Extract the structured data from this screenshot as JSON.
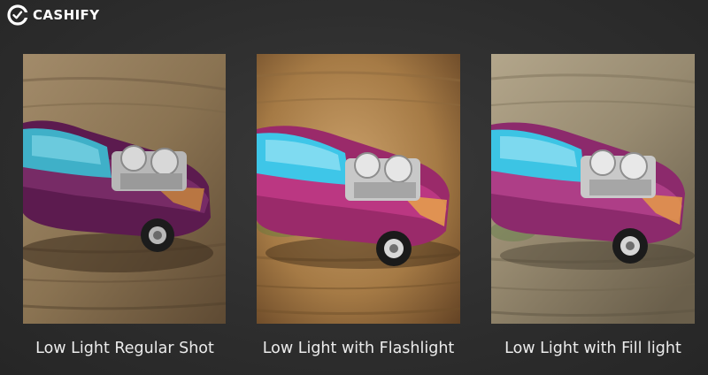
{
  "brand": {
    "name": "CASHIFY",
    "logo_icon": "cashify-logo-icon"
  },
  "comparison": [
    {
      "caption": "Low Light Regular Shot",
      "lighting": "low-light-regular",
      "palette": {
        "table": "#8f7756",
        "table_dark": "#4e3d2a",
        "grain": "#6e5a41",
        "car": "#5c1b4f",
        "car_hi": "#8a3a78",
        "glass": "#3fb0c8"
      }
    },
    {
      "caption": "Low Light with Flashlight",
      "lighting": "flashlight",
      "palette": {
        "table": "#b5894f",
        "table_dark": "#6a4a2a",
        "grain": "#8d6a3d",
        "car": "#9a2a6a",
        "car_hi": "#d24c92",
        "glass": "#3ec6e8"
      }
    },
    {
      "caption": "Low Light with Fill light",
      "lighting": "fill-light",
      "palette": {
        "table": "#9c8f76",
        "table_dark": "#5b5240",
        "grain": "#7d7159",
        "car": "#8c2a6c",
        "car_hi": "#c04a95",
        "glass": "#3cc4e4"
      }
    }
  ]
}
